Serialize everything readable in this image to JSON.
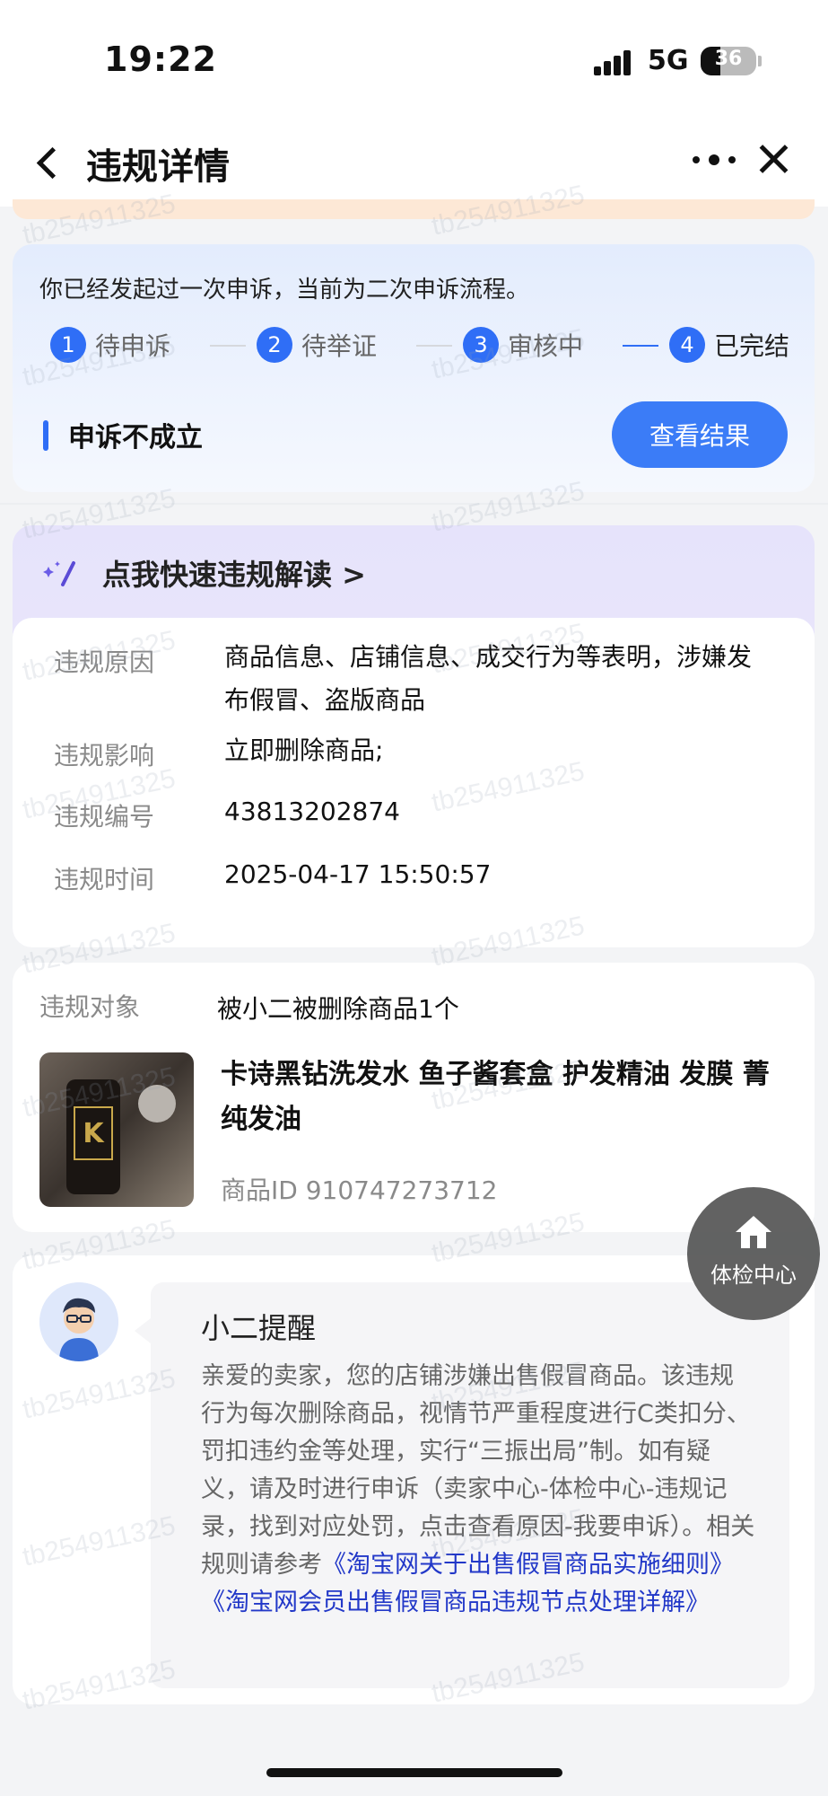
{
  "status_bar": {
    "time": "19:22",
    "network": "5G",
    "battery": "36"
  },
  "nav": {
    "title": "违规详情",
    "icons": [
      "back-icon",
      "more-icon",
      "close-icon"
    ]
  },
  "appeal": {
    "message": "你已经发起过一次申诉，当前为二次申诉流程。",
    "steps": [
      {
        "num": "1",
        "label": "待申诉"
      },
      {
        "num": "2",
        "label": "待举证"
      },
      {
        "num": "3",
        "label": "审核中"
      },
      {
        "num": "4",
        "label": "已完结"
      }
    ],
    "current_step": 4,
    "result": "申诉不成立",
    "result_button": "查看结果"
  },
  "quick_read": {
    "title": "点我快速违规解读 >"
  },
  "violation": {
    "reason_label": "违规原因",
    "reason_value": "商品信息、店铺信息、成交行为等表明，涉嫌发布假冒、盗版商品",
    "impact_label": "违规影响",
    "impact_value": "立即删除商品;",
    "id_label": "违规编号",
    "id_value": "43813202874",
    "time_label": "违规时间",
    "time_value": "2025-04-17 15:50:57"
  },
  "target": {
    "label": "违规对象",
    "value": "被小二被删除商品1个",
    "product_name": "卡诗黑钻洗发水 鱼子酱套盒 护发精油 发膜 菁纯发油",
    "product_id": "商品ID 910747273712",
    "thumb_brand": "K"
  },
  "reminder": {
    "title": "小二提醒",
    "body": "亲爱的卖家，您的店铺涉嫌出售假冒商品。该违规行为每次删除商品，视情节严重程度进行C类扣分、罚扣违约金等处理，实行“三振出局”制。如有疑义，请及时进行申诉（卖家中心-体检中心-违规记录，找到对应处罚，点击查看原因-我要申诉）。相关规则请参考",
    "link1": "《淘宝网关于出售假冒商品实施细则》",
    "link2": "《淘宝网会员出售假冒商品违规节点处理详解》"
  },
  "fab": {
    "label": "体检中心",
    "icon": "home-icon"
  },
  "watermark": "tb254911325",
  "colors": {
    "accent": "#2f6ef6",
    "button": "#3b7cf7",
    "link": "#2238c8",
    "quick_bg": "#e6e3fb",
    "appeal_bg": "#e3ecfd"
  }
}
